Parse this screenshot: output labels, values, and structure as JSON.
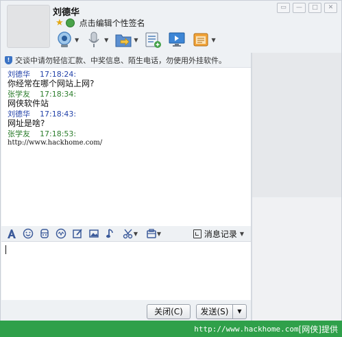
{
  "header": {
    "contact_name": "刘德华",
    "signature": "点击编辑个性签名",
    "window_controls": [
      "minimize-mini",
      "minimize",
      "maximize",
      "close"
    ]
  },
  "toolbar": {
    "tools": [
      "video-camera-icon",
      "microphone-icon",
      "folder-transfer-icon",
      "file-list-icon",
      "screen-share-icon",
      "app-box-icon"
    ]
  },
  "notice": "交谈中请勿轻信汇款、中奖信息、陌生电话，勿使用外挂软件。",
  "messages": [
    {
      "sender": "刘德华",
      "time": "17:18:24:",
      "text": "你经常在哪个网站上网?",
      "kind": "a"
    },
    {
      "sender": "张学友",
      "time": "17:18:34:",
      "text": "网侠软件站",
      "kind": "b"
    },
    {
      "sender": "刘德华",
      "time": "17:18:43:",
      "text": "网址是啥?",
      "kind": "a"
    },
    {
      "sender": "张学友",
      "time": "17:18:53:",
      "text": "http://www.hackhome.com/",
      "kind": "b"
    }
  ],
  "format_bar": {
    "icons": [
      "font-icon",
      "emoji-icon",
      "magic-face-icon",
      "vibrate-icon",
      "handwrite-icon",
      "image-icon",
      "music-icon",
      "screenshot-scissors-icon",
      "app-menu-icon"
    ],
    "history_label": "消息记录"
  },
  "buttons": {
    "close": "关闭(C)",
    "send": "发送(S)"
  },
  "watermark": {
    "url": "http://www.hackhome.com",
    "suffix": "[网侠]提供"
  },
  "colors": {
    "sender_a": "#1f3fa8",
    "sender_b": "#2b7d2b",
    "watermark_bg": "#2fa04a"
  }
}
